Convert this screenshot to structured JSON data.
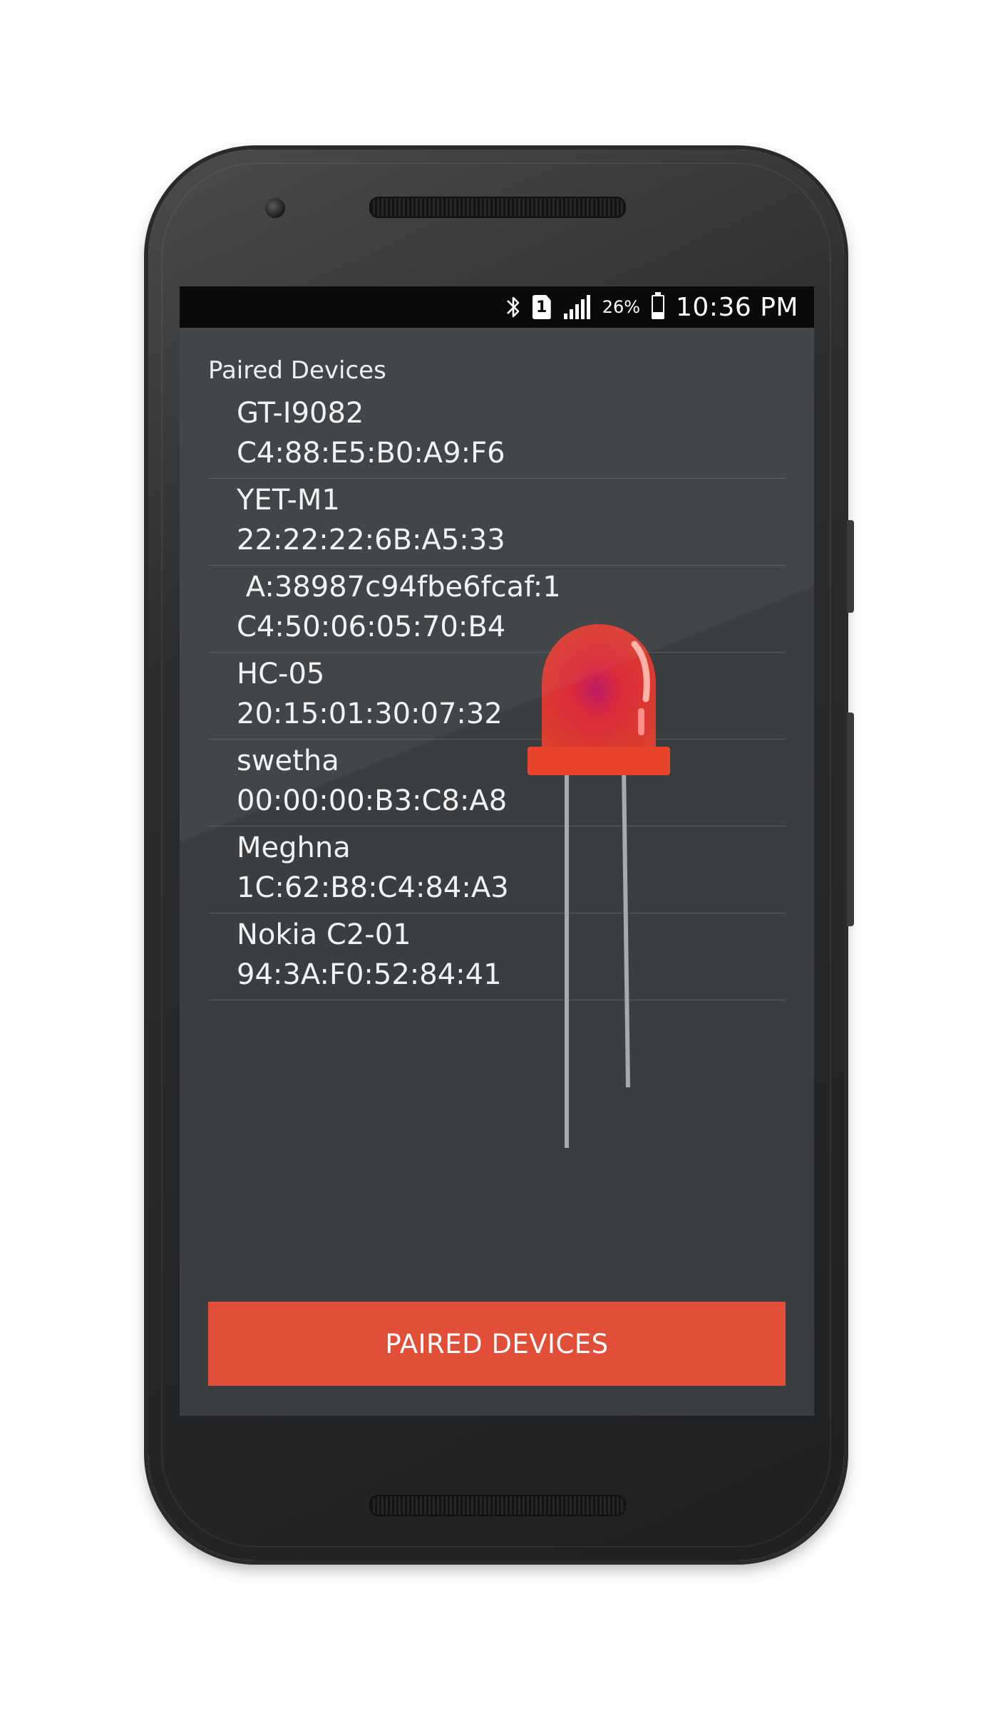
{
  "status_bar": {
    "battery": "26%",
    "battery_level": 0.26,
    "time": "10:36 PM",
    "sim_label": "1",
    "icons": [
      "bluetooth-icon",
      "sim-icon",
      "signal-icon",
      "battery-icon"
    ]
  },
  "section_title": "Paired Devices",
  "devices": [
    {
      "name": "GT-I9082",
      "address": "C4:88:E5:B0:A9:F6"
    },
    {
      "name": "YET-M1",
      "address": "22:22:22:6B:A5:33"
    },
    {
      "name": " A:38987c94fbe6fcaf:1",
      "address": "C4:50:06:05:70:B4"
    },
    {
      "name": "HC-05",
      "address": "20:15:01:30:07:32"
    },
    {
      "name": "swetha",
      "address": "00:00:00:B3:C8:A8"
    },
    {
      "name": "Meghna",
      "address": "1C:62:B8:C4:84:A3"
    },
    {
      "name": "Nokia C2-01",
      "address": "94:3A:F0:52:84:41"
    }
  ],
  "button": {
    "label": "PAIRED DEVICES"
  },
  "colors": {
    "screen_bg": "#3b3e41",
    "button_bg": "#e24f38",
    "led_red": "#e8332a"
  }
}
